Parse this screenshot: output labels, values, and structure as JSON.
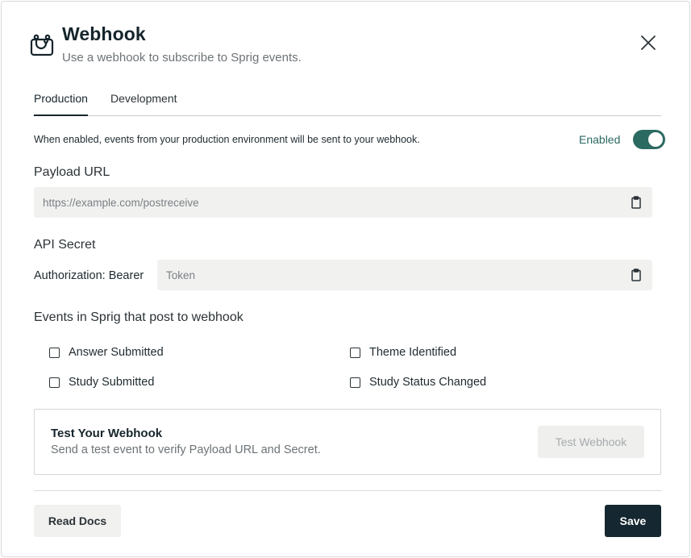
{
  "header": {
    "title": "Webhook",
    "subtitle": "Use a webhook to subscribe to Sprig events.",
    "icon": "webhook-icon",
    "close_icon": "close-icon"
  },
  "tabs": [
    {
      "label": "Production",
      "active": true
    },
    {
      "label": "Development",
      "active": false
    }
  ],
  "enable": {
    "description": "When enabled, events from your production environment will be sent to your webhook.",
    "status_label": "Enabled",
    "enabled": true,
    "accent_color": "#2b6a61"
  },
  "payload": {
    "label": "Payload URL",
    "placeholder": "https://example.com/postreceive",
    "value": ""
  },
  "secret": {
    "label": "API Secret",
    "auth_label": "Authorization: Bearer",
    "placeholder": "Token",
    "value": ""
  },
  "events": {
    "title": "Events in Sprig that post to webhook",
    "items": [
      {
        "label": "Answer Submitted",
        "checked": false
      },
      {
        "label": "Theme Identified",
        "checked": false
      },
      {
        "label": "Study Submitted",
        "checked": false
      },
      {
        "label": "Study Status Changed",
        "checked": false
      }
    ]
  },
  "test": {
    "title": "Test Your Webhook",
    "subtitle": "Send a test event to verify Payload URL and Secret.",
    "button_label": "Test Webhook",
    "button_disabled": true
  },
  "footer": {
    "docs_label": "Read Docs",
    "save_label": "Save",
    "save_color": "#152730"
  }
}
